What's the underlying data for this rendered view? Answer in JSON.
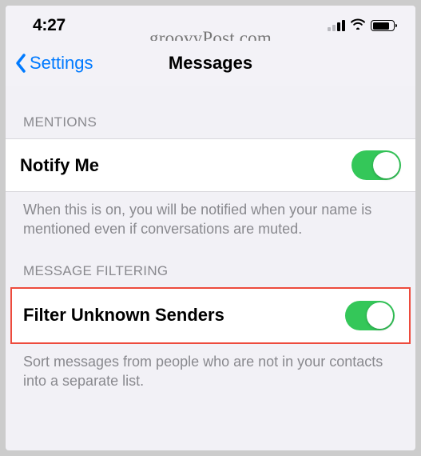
{
  "status_bar": {
    "time": "4:27"
  },
  "watermark": "groovyPost.com",
  "nav": {
    "back_label": "Settings",
    "title": "Messages"
  },
  "sections": {
    "mentions": {
      "header": "MENTIONS",
      "notify_me_label": "Notify Me",
      "footer": "When this is on, you will be notified when your name is mentioned even if conversations are muted."
    },
    "filtering": {
      "header": "MESSAGE FILTERING",
      "filter_unknown_label": "Filter Unknown Senders",
      "footer": "Sort messages from people who are not in your contacts into a separate list."
    }
  },
  "toggles": {
    "notify_me": true,
    "filter_unknown": true
  },
  "colors": {
    "accent": "#007aff",
    "toggle_on": "#34c759",
    "highlight": "#ed4b3d"
  }
}
